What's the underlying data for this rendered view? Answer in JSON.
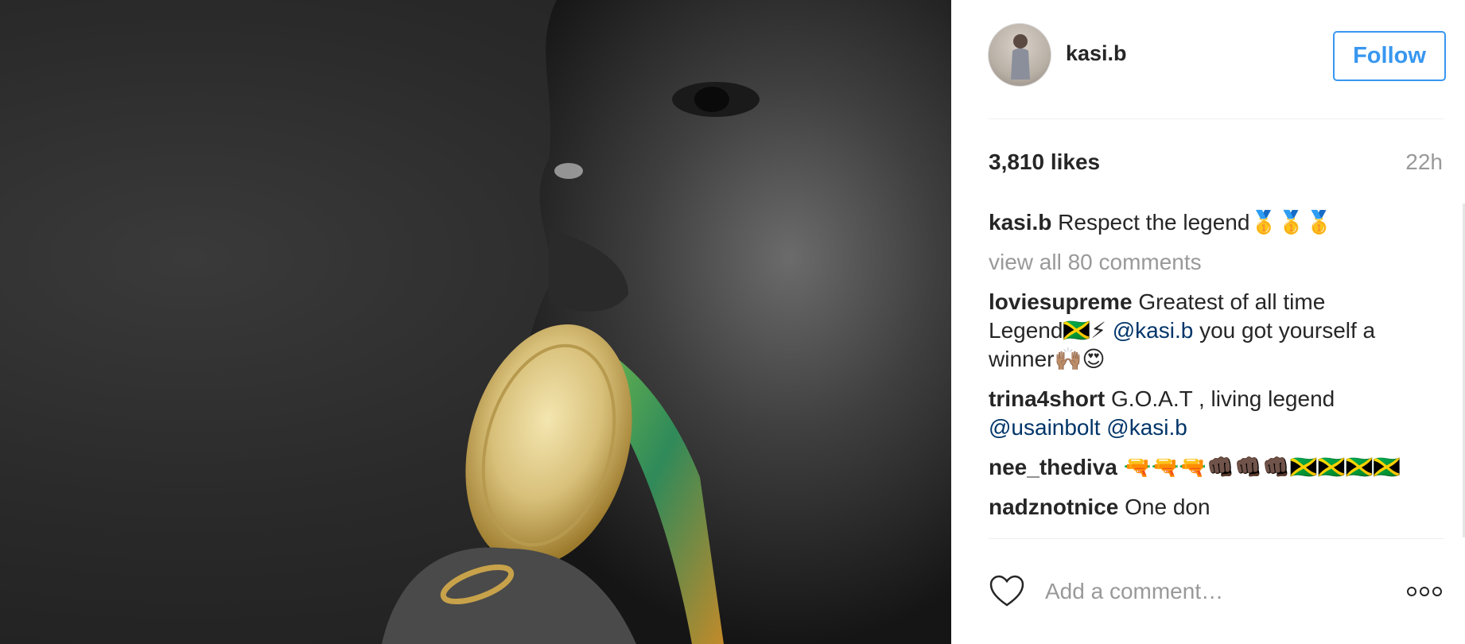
{
  "post": {
    "photo_description_icon": "photo-icon"
  },
  "header": {
    "username": "kasi.b",
    "follow_label": "Follow"
  },
  "stats": {
    "likes": "3,810 likes",
    "time": "22h"
  },
  "caption": {
    "user": "kasi.b",
    "text": "Respect the legend🥇🥇🥇"
  },
  "view_all": "view all 80 comments",
  "comments": [
    {
      "user": "loviesupreme",
      "text_before": "Greatest of all time Legend🇯🇲⚡ ",
      "mention": "@kasi.b",
      "text_after": " you got yourself a winner🙌🏽😍"
    },
    {
      "user": "trina4short",
      "text_before": "G.O.A.T , living legend ",
      "mention": "@usainbolt @kasi.b",
      "text_after": ""
    },
    {
      "user": "nee_thediva",
      "text_before": "🔫🔫🔫👊🏿👊🏿👊🏿🇯🇲🇯🇲🇯🇲🇯🇲",
      "mention": "",
      "text_after": ""
    },
    {
      "user": "nadznotnice",
      "text_before": "One don",
      "mention": "",
      "text_after": ""
    }
  ],
  "footer": {
    "add_comment_placeholder": "Add a comment…"
  },
  "colors": {
    "accent": "#3897f0",
    "mention": "#003569",
    "muted": "#999999"
  }
}
